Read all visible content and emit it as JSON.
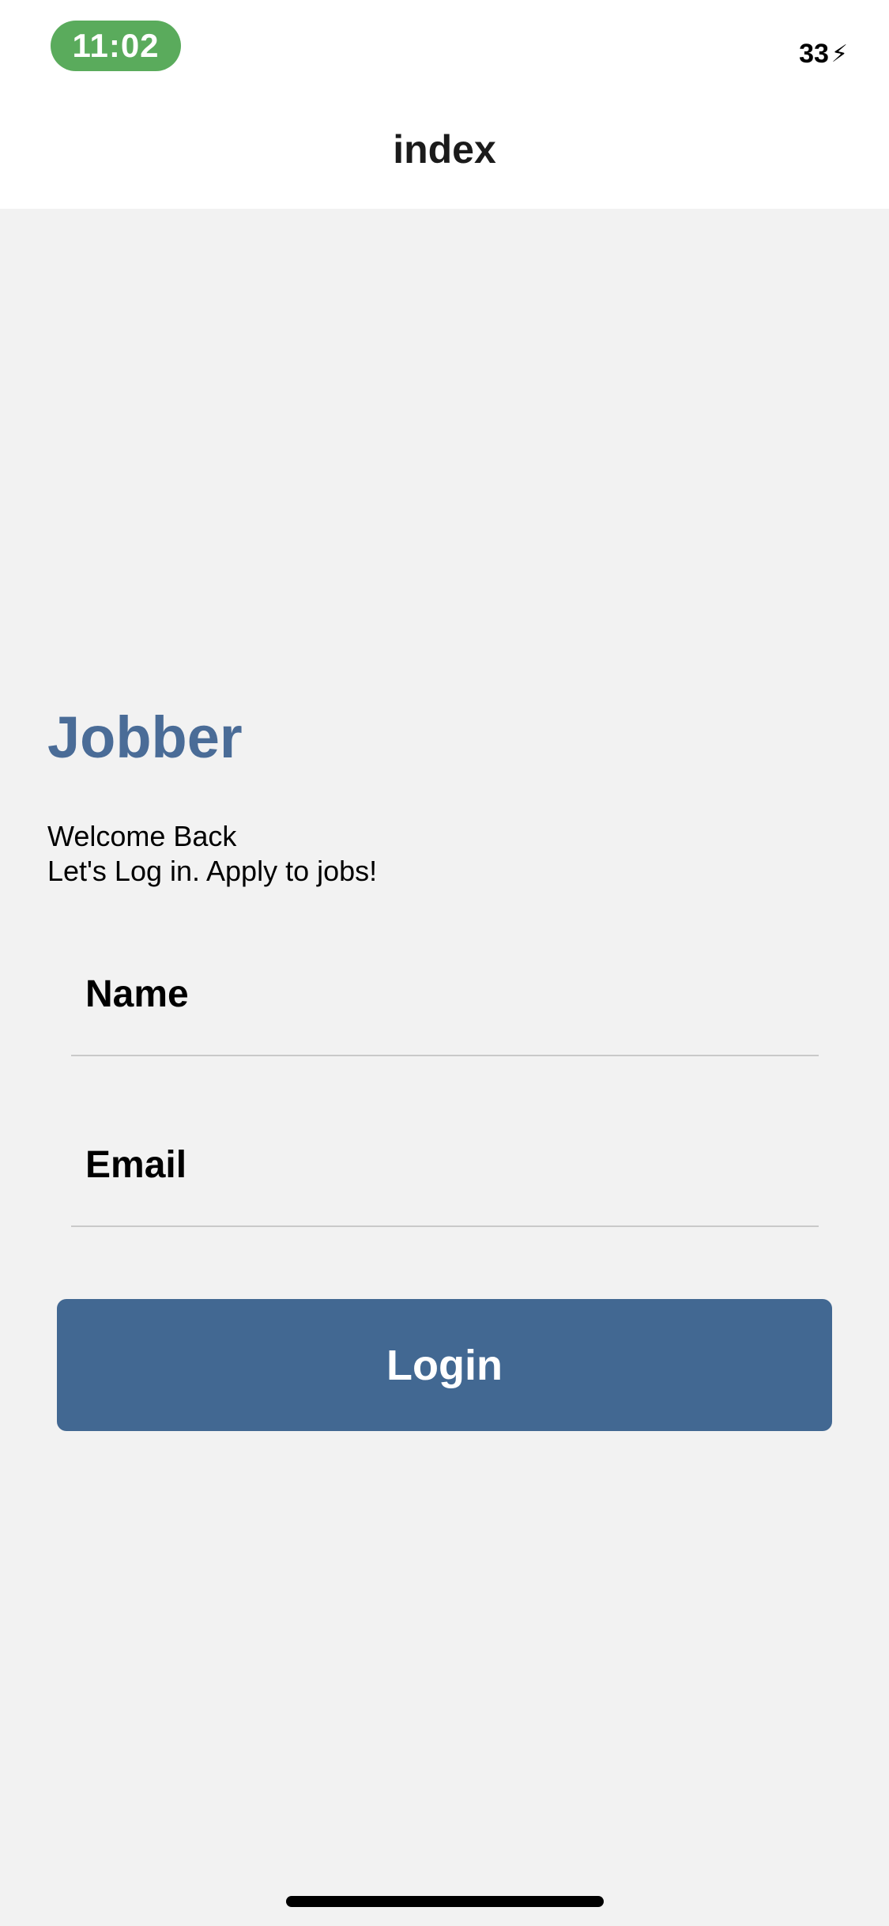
{
  "status_bar": {
    "time": "11:02",
    "battery_level": "33",
    "time_pill_color": "#5aab5c"
  },
  "nav": {
    "title": "index"
  },
  "brand": {
    "name": "Jobber",
    "color": "#4a6c97"
  },
  "welcome": {
    "line1": "Welcome Back",
    "line2": "Let's Log in. Apply to jobs!"
  },
  "form": {
    "name_placeholder": "Name",
    "email_placeholder": "Email",
    "login_label": "Login",
    "button_color": "#426892"
  }
}
